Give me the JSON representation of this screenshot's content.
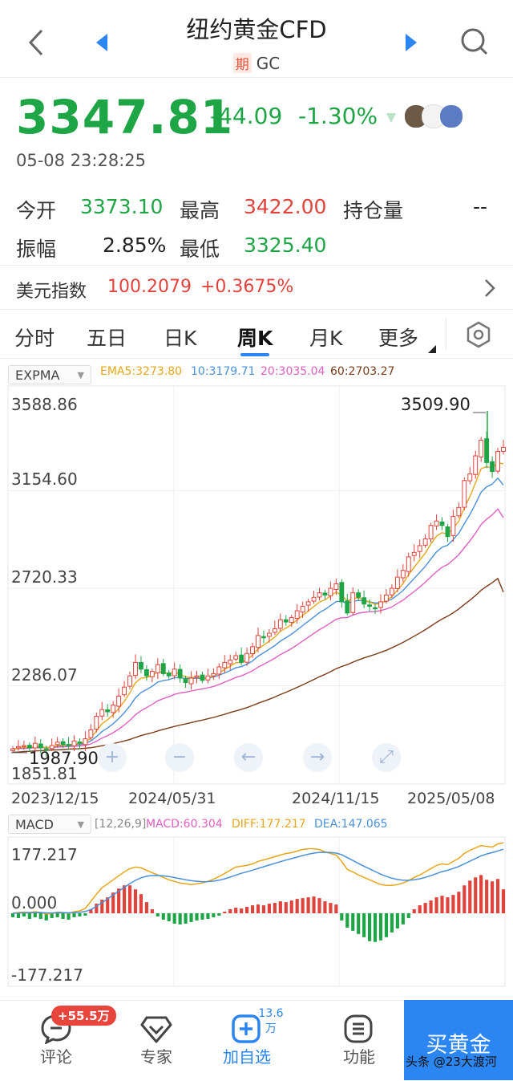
{
  "header": {
    "title": "纽约黄金CFD",
    "tag": "期",
    "code": "GC"
  },
  "quote": {
    "price": "3347.81",
    "change": "-44.09",
    "change_pct": "-1.30%",
    "time": "05-08 23:28:25"
  },
  "stats": {
    "open_label": "今开",
    "open": "3373.10",
    "high_label": "最高",
    "high": "3422.00",
    "oi_label": "持仓量",
    "oi": "--",
    "amp_label": "振幅",
    "amp": "2.85%",
    "low_label": "最低",
    "low": "3325.40"
  },
  "dxy": {
    "label": "美元指数",
    "value": "100.2079",
    "change": "+0.3675%"
  },
  "tabs": [
    "分时",
    "五日",
    "日K",
    "周K",
    "月K",
    "更多"
  ],
  "active_tab": "周K",
  "main_chart_legend": {
    "indicator": "EXPMA",
    "ema5": "EMA5:3273.80",
    "ema10": "10:3179.71",
    "ema20": "20:3035.04",
    "ema60": "60:2703.27"
  },
  "macd_legend": {
    "indicator": "MACD",
    "params": "[12,26,9]",
    "macd": "MACD:60.304",
    "diff": "DIFF:177.217",
    "dea": "DEA:147.065"
  },
  "colors": {
    "up": "#e0433b",
    "down": "#1ea546",
    "ema5": "#e6a61c",
    "ema10": "#4a90d9",
    "ema20": "#e05fc0",
    "ema60": "#7b3b18",
    "accent": "#2b85f3"
  },
  "chart_data": [
    {
      "type": "candlestick",
      "title": "",
      "y_ticks": [
        "3588.86",
        "3154.60",
        "2720.33",
        "2286.07",
        "1851.81"
      ],
      "ylim": [
        1851.81,
        3588.86
      ],
      "x_ticks": [
        "2023/12/15",
        "2024/05/31",
        "2024/11/15",
        "2025/05/08"
      ],
      "max_label": "3509.90",
      "min_label": "1987.90",
      "close": [
        2005,
        2015,
        2020,
        2010,
        2030,
        2010,
        2000,
        2020,
        2035,
        2025,
        2020,
        2040,
        2030,
        2050,
        2090,
        2150,
        2180,
        2170,
        2200,
        2240,
        2280,
        2330,
        2390,
        2360,
        2330,
        2350,
        2380,
        2340,
        2330,
        2360,
        2320,
        2300,
        2320,
        2330,
        2310,
        2330,
        2340,
        2370,
        2390,
        2400,
        2420,
        2390,
        2430,
        2460,
        2510,
        2500,
        2520,
        2540,
        2580,
        2570,
        2590,
        2620,
        2640,
        2660,
        2680,
        2700,
        2690,
        2720,
        2740,
        2660,
        2610,
        2700,
        2680,
        2650,
        2640,
        2630,
        2660,
        2690,
        2720,
        2770,
        2800,
        2860,
        2880,
        2910,
        2940,
        3000,
        3020,
        3000,
        2950,
        3040,
        3080,
        3200,
        3230,
        3310,
        3380,
        3280,
        3240,
        3330,
        3348
      ],
      "ema5": [
        2005,
        2008,
        2012,
        2011,
        2017,
        2015,
        2010,
        2013,
        2020,
        2022,
        2021,
        2027,
        2028,
        2035,
        2053,
        2085,
        2117,
        2135,
        2157,
        2185,
        2217,
        2255,
        2300,
        2320,
        2323,
        2332,
        2348,
        2345,
        2340,
        2347,
        2338,
        2325,
        2323,
        2325,
        2320,
        2323,
        2329,
        2343,
        2359,
        2373,
        2389,
        2389,
        2403,
        2422,
        2451,
        2467,
        2485,
        2503,
        2529,
        2543,
        2559,
        2579,
        2599,
        2619,
        2639,
        2659,
        2669,
        2686,
        2704,
        2689,
        2663,
        2675,
        2677,
        2668,
        2659,
        2649,
        2653,
        2665,
        2683,
        2712,
        2741,
        2781,
        2814,
        2846,
        2877,
        2918,
        2952,
        2968,
        2962,
        2988,
        3019,
        3079,
        3129,
        3190,
        3253,
        3262,
        3255,
        3280,
        3274
      ],
      "ema10": [
        2005,
        2007,
        2010,
        2010,
        2014,
        2013,
        2011,
        2013,
        2017,
        2019,
        2019,
        2023,
        2024,
        2029,
        2040,
        2060,
        2082,
        2098,
        2117,
        2140,
        2166,
        2196,
        2232,
        2256,
        2269,
        2284,
        2302,
        2309,
        2313,
        2322,
        2322,
        2318,
        2319,
        2320,
        2319,
        2321,
        2325,
        2333,
        2343,
        2354,
        2366,
        2371,
        2382,
        2396,
        2418,
        2433,
        2449,
        2465,
        2485,
        2500,
        2516,
        2535,
        2554,
        2573,
        2592,
        2612,
        2626,
        2643,
        2661,
        2662,
        2653,
        2662,
        2666,
        2663,
        2660,
        2655,
        2656,
        2662,
        2672,
        2690,
        2710,
        2738,
        2764,
        2791,
        2818,
        2851,
        2882,
        2903,
        2912,
        2937,
        2965,
        3008,
        3049,
        3096,
        3148,
        3172,
        3184,
        3211,
        3180
      ],
      "ema20": [
        2005,
        2006,
        2007,
        2008,
        2010,
        2010,
        2010,
        2011,
        2013,
        2014,
        2015,
        2017,
        2018,
        2021,
        2027,
        2039,
        2053,
        2064,
        2077,
        2093,
        2111,
        2132,
        2157,
        2175,
        2189,
        2203,
        2219,
        2229,
        2237,
        2248,
        2254,
        2257,
        2263,
        2268,
        2272,
        2277,
        2283,
        2292,
        2302,
        2312,
        2323,
        2330,
        2341,
        2353,
        2369,
        2382,
        2395,
        2409,
        2425,
        2438,
        2452,
        2468,
        2485,
        2502,
        2519,
        2536,
        2550,
        2566,
        2582,
        2589,
        2590,
        2601,
        2609,
        2613,
        2616,
        2617,
        2621,
        2628,
        2637,
        2653,
        2667,
        2687,
        2706,
        2726,
        2747,
        2771,
        2794,
        2814,
        2826,
        2847,
        2870,
        2901,
        2932,
        2965,
        3004,
        3028,
        3047,
        3073,
        3035
      ],
      "ema60": [
        1990,
        1991,
        1993,
        1994,
        1996,
        1997,
        1998,
        2000,
        2001,
        2002,
        2004,
        2005,
        2006,
        2008,
        2010,
        2014,
        2019,
        2023,
        2028,
        2034,
        2040,
        2047,
        2056,
        2064,
        2071,
        2077,
        2085,
        2092,
        2098,
        2105,
        2111,
        2116,
        2122,
        2128,
        2133,
        2139,
        2145,
        2152,
        2159,
        2167,
        2174,
        2181,
        2189,
        2198,
        2208,
        2217,
        2226,
        2236,
        2247,
        2257,
        2268,
        2279,
        2290,
        2302,
        2314,
        2326,
        2337,
        2349,
        2362,
        2372,
        2380,
        2391,
        2401,
        2410,
        2418,
        2426,
        2435,
        2444,
        2455,
        2467,
        2479,
        2493,
        2507,
        2521,
        2536,
        2552,
        2568,
        2583,
        2596,
        2611,
        2628,
        2648,
        2667,
        2688,
        2711,
        2729,
        2745,
        2764,
        2703
      ]
    },
    {
      "type": "bar",
      "title": "",
      "y_ticks": [
        "177.217",
        "0.000",
        "-177.217"
      ],
      "ylim": [
        -177.217,
        177.217
      ],
      "macd": [
        -10,
        -12,
        -8,
        -14,
        -10,
        -14,
        -18,
        -12,
        -10,
        -14,
        -16,
        -10,
        -8,
        -6,
        10,
        24,
        34,
        40,
        52,
        62,
        70,
        70,
        60,
        48,
        28,
        10,
        -8,
        -16,
        -20,
        -26,
        -28,
        -26,
        -22,
        -18,
        -16,
        -14,
        -10,
        -6,
        4,
        10,
        14,
        12,
        16,
        20,
        22,
        20,
        24,
        26,
        30,
        28,
        32,
        36,
        38,
        40,
        42,
        38,
        30,
        26,
        22,
        -18,
        -36,
        -44,
        -52,
        -60,
        -70,
        -72,
        -68,
        -60,
        -48,
        -38,
        -28,
        -12,
        10,
        20,
        26,
        32,
        40,
        44,
        40,
        46,
        54,
        70,
        82,
        90,
        96,
        84,
        80,
        86,
        60
      ],
      "diff": [
        0,
        2,
        3,
        2,
        4,
        2,
        -2,
        0,
        3,
        2,
        0,
        4,
        6,
        12,
        30,
        48,
        64,
        74,
        84,
        94,
        104,
        112,
        116,
        114,
        108,
        102,
        96,
        90,
        84,
        80,
        76,
        74,
        72,
        74,
        76,
        80,
        86,
        92,
        100,
        108,
        116,
        118,
        120,
        124,
        130,
        134,
        138,
        142,
        146,
        150,
        152,
        156,
        160,
        162,
        162,
        160,
        154,
        150,
        146,
        130,
        110,
        104,
        96,
        90,
        84,
        78,
        72,
        70,
        70,
        72,
        76,
        82,
        90,
        96,
        104,
        112,
        120,
        124,
        122,
        130,
        138,
        150,
        158,
        164,
        170,
        168,
        166,
        174,
        177
      ]
    }
  ],
  "overlay_buttons": [
    "+",
    "−",
    "←",
    "→",
    "⤢"
  ],
  "bottom_nav": {
    "comment_label": "评论",
    "comment_badge": "+55.5万",
    "expert_label": "专家",
    "add_label": "加自选",
    "add_count": "13.6万",
    "func_label": "功能",
    "buy_label": "买黄金",
    "watermark": "头条 @23大渡河"
  }
}
